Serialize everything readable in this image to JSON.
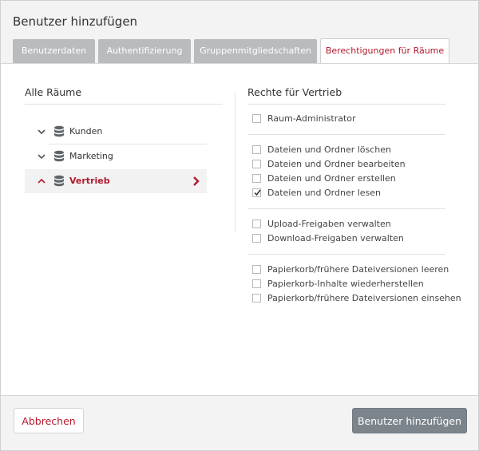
{
  "dialog": {
    "title": "Benutzer hinzufügen"
  },
  "tabs": [
    {
      "label": "Benutzerdaten",
      "active": false
    },
    {
      "label": "Authentifizierung",
      "active": false
    },
    {
      "label": "Gruppenmitgliedschaften",
      "active": false
    },
    {
      "label": "Berechtigungen für Räume",
      "active": true
    }
  ],
  "rooms": {
    "title": "Alle Räume",
    "items": [
      {
        "label": "Kunden",
        "expanded": false,
        "selected": false,
        "icon": "database-icon"
      },
      {
        "label": "Marketing",
        "expanded": false,
        "selected": false,
        "icon": "database-icon"
      },
      {
        "label": "Vertrieb",
        "expanded": true,
        "selected": true,
        "icon": "database-icon"
      }
    ]
  },
  "rights": {
    "title": "Rechte für Vertrieb",
    "groups": [
      [
        {
          "label": "Raum-Administrator",
          "checked": false
        }
      ],
      [
        {
          "label": "Dateien und Ordner löschen",
          "checked": false
        },
        {
          "label": "Dateien und Ordner bearbeiten",
          "checked": false
        },
        {
          "label": "Dateien und Ordner erstellen",
          "checked": false
        },
        {
          "label": "Dateien und Ordner lesen",
          "checked": true
        }
      ],
      [
        {
          "label": "Upload-Freigaben verwalten",
          "checked": false
        },
        {
          "label": "Download-Freigaben verwalten",
          "checked": false
        }
      ],
      [
        {
          "label": "Papierkorb/frühere Dateiversionen leeren",
          "checked": false
        },
        {
          "label": "Papierkorb-Inhalte wiederherstellen",
          "checked": false
        },
        {
          "label": "Papierkorb/frühere Dateiversionen einsehen",
          "checked": false
        }
      ]
    ]
  },
  "footer": {
    "cancel_label": "Abbrechen",
    "submit_label": "Benutzer hinzufügen"
  },
  "colors": {
    "accent": "#b2192e",
    "tab_inactive": "#b8bcbf",
    "primary_button": "#7c858b"
  }
}
